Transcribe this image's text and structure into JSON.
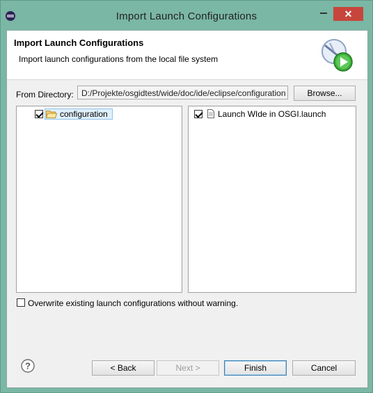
{
  "window": {
    "title": "Import Launch Configurations",
    "close_glyph": "✕"
  },
  "banner": {
    "title": "Import Launch Configurations",
    "description": "Import launch configurations from the local file system",
    "icon": "launch-config-wizard-icon"
  },
  "directory": {
    "label": "From Directory:",
    "value": "D:/Projekte/osgidtest/wide/doc/ide/eclipse/configuration",
    "browse_label": "Browse..."
  },
  "folder_tree": {
    "items": [
      {
        "label": "configuration",
        "checked": true,
        "selected": true,
        "icon": "folder-open-icon"
      }
    ]
  },
  "file_list": {
    "items": [
      {
        "label": "Launch WIde in OSGI.launch",
        "checked": true,
        "icon": "document-icon"
      }
    ]
  },
  "options": {
    "overwrite_label": "Overwrite existing launch configurations without warning.",
    "overwrite_checked": false
  },
  "buttons": {
    "back": "< Back",
    "next": "Next >",
    "finish": "Finish",
    "cancel": "Cancel"
  },
  "colors": {
    "frame": "#7ab7a4",
    "close_button": "#c7463b",
    "selection_bg": "#dff0fb"
  }
}
